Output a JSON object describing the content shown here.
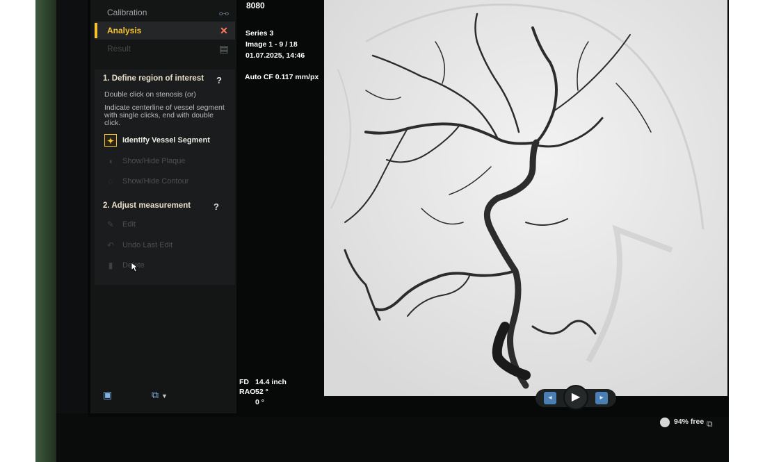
{
  "steps": [
    {
      "label": "Calibration",
      "icon": "calibration-icon"
    },
    {
      "label": "Analysis",
      "icon": "analysis-icon"
    },
    {
      "label": "Result",
      "icon": "result-icon"
    }
  ],
  "section1": {
    "title": "1. Define region of interest",
    "help": "?",
    "instr1": "Double click on stenosis (or)",
    "instr2": "Indicate centerline of vessel segment with single clicks, end with double click.",
    "tools": [
      {
        "label": "Identify Vessel Segment",
        "enabled": true
      },
      {
        "label": "Show/Hide Plaque",
        "enabled": false
      },
      {
        "label": "Show/Hide Contour",
        "enabled": false
      }
    ]
  },
  "section2": {
    "title": "2. Adjust measurement",
    "help": "?",
    "tools": [
      {
        "label": "Edit",
        "enabled": false
      },
      {
        "label": "Undo Last Edit",
        "enabled": false
      },
      {
        "label": "Delete",
        "enabled": false
      }
    ]
  },
  "info": {
    "id": "8080",
    "series": "Series 3",
    "image": "Image 1 - 9 / 18",
    "datetime": "01.07.2025, 14:46",
    "calibration": "Auto CF 0.117 mm/px",
    "fd_label": "FD",
    "fd_value": "14.4 inch",
    "rao_label": "RAO",
    "rao_value": "52 °",
    "angle2": "0 °"
  },
  "status": {
    "free": "94% free"
  },
  "colors": {
    "accent": "#f4c430",
    "panel": "#141515",
    "button_blue": "#4b7fb4"
  }
}
